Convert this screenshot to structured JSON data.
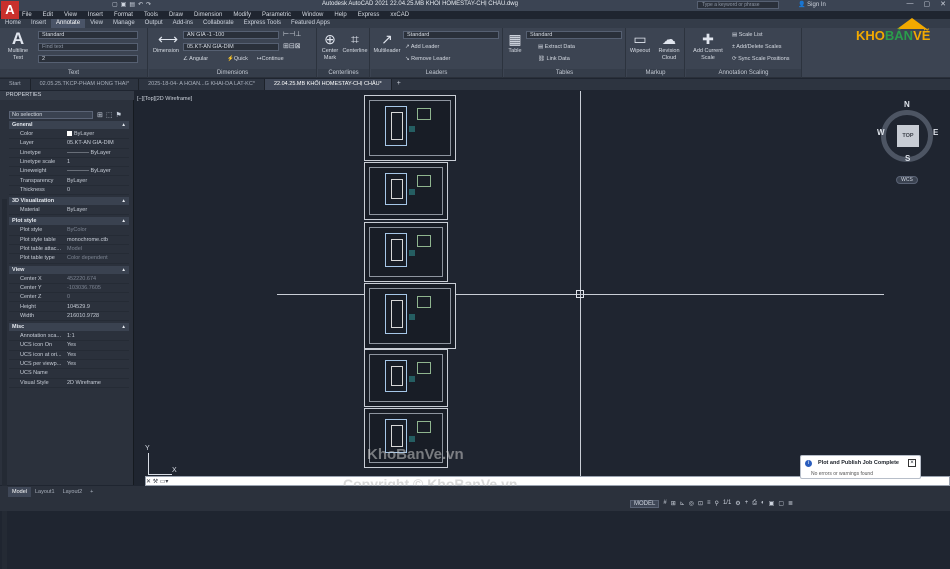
{
  "app": {
    "logo": "A",
    "title": "Autodesk AutoCAD 2021   22.04.25.MB KHỐI HOMESTAY-CHỊ CHÂU.dwg",
    "search_placeholder": "Type a keyword or phrase",
    "signin": "Sign In"
  },
  "menu": [
    "File",
    "Edit",
    "View",
    "Insert",
    "Format",
    "Tools",
    "Draw",
    "Dimension",
    "Modify",
    "Parametric",
    "Window",
    "Help",
    "Express",
    "xxCAD"
  ],
  "ribbon_tabs": [
    "Home",
    "Insert",
    "Annotate",
    "View",
    "Manage",
    "Output",
    "Add-ins",
    "Collaborate",
    "Express Tools",
    "Featured Apps"
  ],
  "active_ribbon_tab": "Annotate",
  "ribbon": {
    "text": {
      "title": "Text",
      "multiline": "Multiline Text",
      "style": "Standard",
      "find_placeholder": "Find text",
      "height": "2"
    },
    "dimensions": {
      "title": "Dimensions",
      "dimension": "Dimension",
      "dimstyle": "AN GIA -1 -100",
      "layer": "05.KT-AN GIA-DIM",
      "angular": "Angular",
      "quick": "Quick",
      "continue": "Continue"
    },
    "centerlines": {
      "title": "Centerlines",
      "center_mark": "Center Mark",
      "centerline": "Centerline"
    },
    "leaders": {
      "title": "Leaders",
      "multileader": "Multileader",
      "style": "Standard",
      "add": "Add Leader",
      "remove": "Remove Leader"
    },
    "tables": {
      "title": "Tables",
      "table": "Table",
      "style": "Standard",
      "extract": "Extract Data",
      "link": "Link Data"
    },
    "markup": {
      "title": "Markup",
      "wipeout": "Wipeout",
      "revision_cloud": "Revision Cloud"
    },
    "scaling": {
      "title": "Annotation Scaling",
      "add_current": "Add Current Scale",
      "scale_list": "Scale List",
      "add_delete": "Add/Delete Scales",
      "sync": "Sync Scale Positions"
    }
  },
  "doc_tabs": [
    {
      "label": "Start",
      "active": false
    },
    {
      "label": "02.05.25.TKCP-PHAM HONG THAI*",
      "active": false
    },
    {
      "label": "2025-18-04- A HOAN...G KHAI-DA LAT-KC*",
      "active": false
    },
    {
      "label": "22.04.25.MB KHỐI HOMESTAY-CHỊ CHÂU*",
      "active": true
    }
  ],
  "properties": {
    "title": "PROPERTIES",
    "selection": "No selection",
    "sections": [
      {
        "name": "General",
        "rows": [
          {
            "k": "Color",
            "v": "ByLayer"
          },
          {
            "k": "Layer",
            "v": "05.KT-AN GIA-DIM"
          },
          {
            "k": "Linetype",
            "v": "———— ByLayer"
          },
          {
            "k": "Linetype scale",
            "v": "1"
          },
          {
            "k": "Lineweight",
            "v": "———— ByLayer"
          },
          {
            "k": "Transparency",
            "v": "ByLayer"
          },
          {
            "k": "Thickness",
            "v": "0"
          }
        ]
      },
      {
        "name": "3D Visualization",
        "rows": [
          {
            "k": "Material",
            "v": "ByLayer"
          }
        ]
      },
      {
        "name": "Plot style",
        "rows": [
          {
            "k": "Plot style",
            "v": "ByColor",
            "dim": true
          },
          {
            "k": "Plot style table",
            "v": "monochrome.ctb"
          },
          {
            "k": "Plot table attac...",
            "v": "Model",
            "dim": true
          },
          {
            "k": "Plot table type",
            "v": "Color dependent",
            "dim": true
          }
        ]
      },
      {
        "name": "View",
        "rows": [
          {
            "k": "Center X",
            "v": "452220.674",
            "dim": true
          },
          {
            "k": "Center Y",
            "v": "-103036.7605",
            "dim": true
          },
          {
            "k": "Center Z",
            "v": "0",
            "dim": true
          },
          {
            "k": "Height",
            "v": "104529.9"
          },
          {
            "k": "Width",
            "v": "216010.9728"
          }
        ]
      },
      {
        "name": "Misc",
        "rows": [
          {
            "k": "Annotation sca...",
            "v": "1:1"
          },
          {
            "k": "UCS icon On",
            "v": "Yes"
          },
          {
            "k": "UCS icon at ori...",
            "v": "Yes"
          },
          {
            "k": "UCS per viewp...",
            "v": "Yes"
          },
          {
            "k": "UCS Name",
            "v": ""
          },
          {
            "k": "Visual Style",
            "v": "2D Wireframe"
          }
        ]
      }
    ]
  },
  "viewport_label": "[−][Top][2D Wireframe]",
  "viewcube": {
    "n": "N",
    "s": "S",
    "e": "E",
    "w": "W",
    "top": "TOP",
    "wcs": "WCS"
  },
  "ucs": {
    "y": "Y",
    "x": "X"
  },
  "layout_tabs": [
    {
      "label": "Model",
      "active": true
    },
    {
      "label": "Layout1",
      "active": false
    },
    {
      "label": "Layout2",
      "active": false
    },
    {
      "label": "+",
      "active": false
    }
  ],
  "status": {
    "model": "MODEL",
    "grid": "#",
    "snap": "⊞",
    "scale": "1/1",
    "gear": "⚙"
  },
  "toast": {
    "title": "Plot and Publish Job Complete",
    "message": "No errors or warnings found",
    "close": "×"
  },
  "brand": {
    "k": "KHO",
    "b": "BẢN",
    "v": "VẼ"
  },
  "watermarks": {
    "site": "KhoBanVe.vn",
    "copyright": "Copyright © KhoBanVe.vn"
  }
}
